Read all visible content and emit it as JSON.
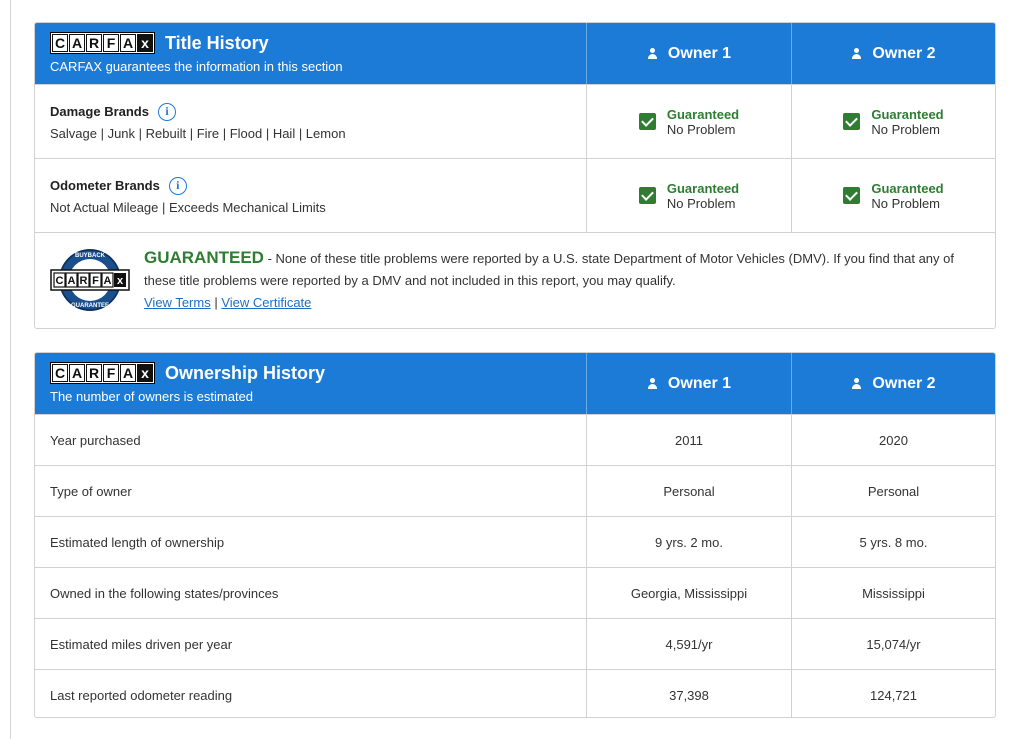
{
  "title_history": {
    "title": "Title History",
    "subtitle": "CARFAX guarantees the information in this section",
    "owners": [
      "Owner 1",
      "Owner 2"
    ],
    "rows": [
      {
        "name": "Damage Brands",
        "desc": "Salvage | Junk | Rebuilt | Fire | Flood | Hail | Lemon",
        "values": [
          {
            "status": "Guaranteed",
            "result": "No Problem"
          },
          {
            "status": "Guaranteed",
            "result": "No Problem"
          }
        ]
      },
      {
        "name": "Odometer Brands",
        "desc": "Not Actual Mileage | Exceeds Mechanical Limits",
        "values": [
          {
            "status": "Guaranteed",
            "result": "No Problem"
          },
          {
            "status": "Guaranteed",
            "result": "No Problem"
          }
        ]
      }
    ],
    "guarantee": {
      "heading": "GUARANTEED",
      "text": " - None of these title problems were reported by a U.S. state Department of Motor Vehicles (DMV). If you find that any of these title problems were reported by a DMV and not included in this report, you may qualify.",
      "link_terms": "View Terms",
      "separator": " | ",
      "link_certificate": "View Certificate"
    }
  },
  "logo": {
    "letters": [
      "C",
      "A",
      "R",
      "F",
      "A",
      "x"
    ]
  },
  "ownership_history": {
    "title": "Ownership History",
    "subtitle": "The number of owners is estimated",
    "owners": [
      "Owner 1",
      "Owner 2"
    ],
    "rows": [
      {
        "label": "Year purchased",
        "values": [
          "2011",
          "2020"
        ]
      },
      {
        "label": "Type of owner",
        "values": [
          "Personal",
          "Personal"
        ]
      },
      {
        "label": "Estimated length of ownership",
        "values": [
          "9 yrs. 2 mo.",
          "5 yrs. 8 mo."
        ]
      },
      {
        "label": "Owned in the following states/provinces",
        "values": [
          "Georgia, Mississippi",
          "Mississippi"
        ]
      },
      {
        "label": "Estimated miles driven per year",
        "values": [
          "4,591/yr",
          "15,074/yr"
        ]
      },
      {
        "label": "Last reported odometer reading",
        "values": [
          "37,398",
          "124,721"
        ]
      }
    ]
  },
  "colors": {
    "header_blue": "#1d7bd8",
    "guarantee_green": "#2e7d32",
    "link_blue": "#1d6fc4"
  }
}
